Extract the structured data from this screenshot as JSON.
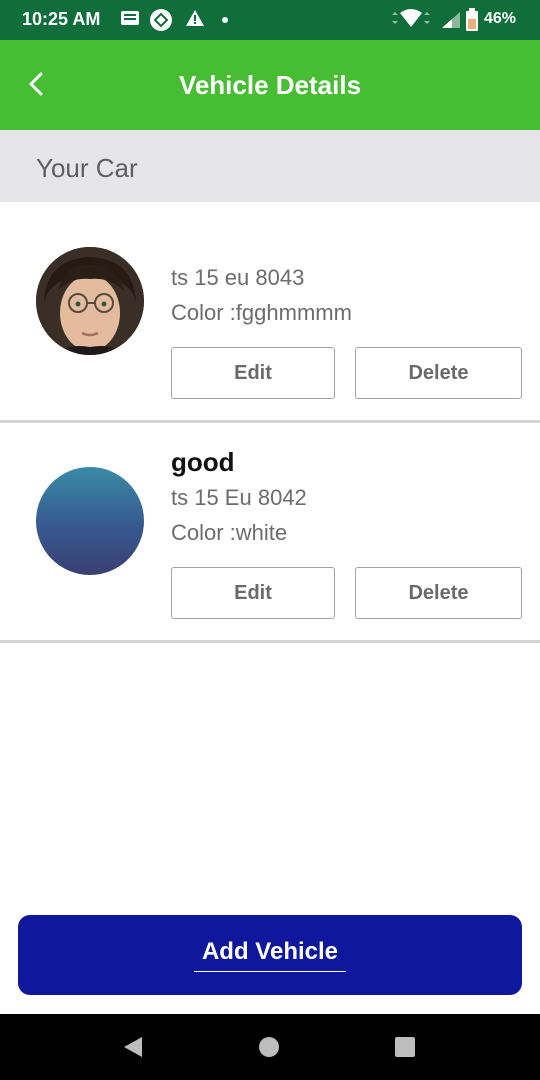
{
  "status_bar": {
    "time": "10:25 AM",
    "battery": "46%"
  },
  "app_bar": {
    "title": "Vehicle Details"
  },
  "section": {
    "title": "Your Car"
  },
  "vehicles": [
    {
      "name": "",
      "plate": "ts 15 eu 8043",
      "color": "Color :fgghmmmm",
      "edit_label": "Edit",
      "delete_label": "Delete"
    },
    {
      "name": "good",
      "plate": "ts 15 Eu 8042",
      "color": "Color :white",
      "edit_label": "Edit",
      "delete_label": "Delete"
    }
  ],
  "add_button": {
    "label": "Add Vehicle"
  },
  "colors": {
    "status_bar": "#0f6e3a",
    "app_bar": "#47bd33",
    "section_bg": "#e6e5e8",
    "add_button": "#0f179d"
  }
}
